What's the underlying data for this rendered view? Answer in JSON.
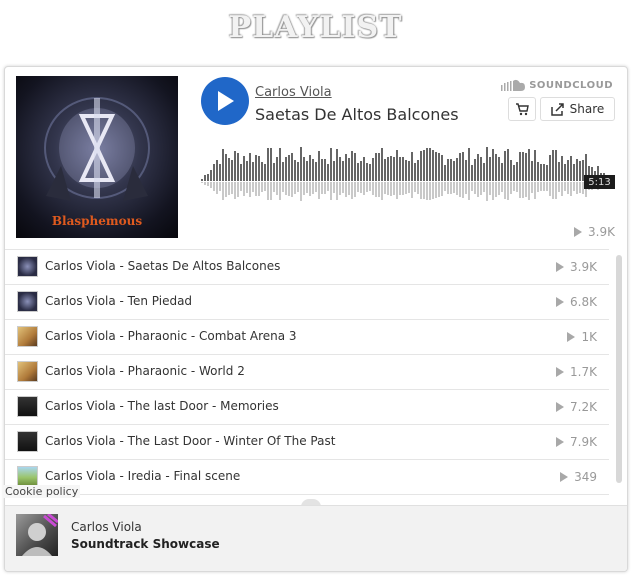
{
  "page": {
    "title": "PLAYLIST"
  },
  "player": {
    "artist": "Carlos Viola",
    "track_title": "Saetas De Altos Balcones",
    "brand": "SOUNDCLOUD",
    "share_label": "Share",
    "duration": "5:13",
    "plays": "3.9K",
    "artwork_text": "Blasphemous",
    "colors": {
      "play_button": "#2067c8",
      "waveform": "#666666",
      "waveform_reflection": "#c9c9c9"
    }
  },
  "tracks": [
    {
      "title": "Carlos Viola - Saetas De Altos Balcones",
      "plays": "3.9K",
      "thumb": "dark-blue"
    },
    {
      "title": "Carlos Viola - Ten Piedad",
      "plays": "6.8K",
      "thumb": "dark-blue"
    },
    {
      "title": "Carlos Viola - Pharaonic - Combat Arena 3",
      "plays": "1K",
      "thumb": "tan"
    },
    {
      "title": "Carlos Viola - Pharaonic - World 2",
      "plays": "1.7K",
      "thumb": "tan"
    },
    {
      "title": "Carlos Viola - The last Door - Memories",
      "plays": "7.2K",
      "thumb": "black"
    },
    {
      "title": "Carlos Viola - The Last Door - Winter Of The Past",
      "plays": "7.9K",
      "thumb": "black"
    },
    {
      "title": "Carlos Viola - Iredia - Final scene",
      "plays": "349",
      "thumb": "green"
    }
  ],
  "footer": {
    "artist": "Carlos Viola",
    "playlist_name": "Soundtrack Showcase",
    "cookie_policy": "Cookie policy"
  }
}
